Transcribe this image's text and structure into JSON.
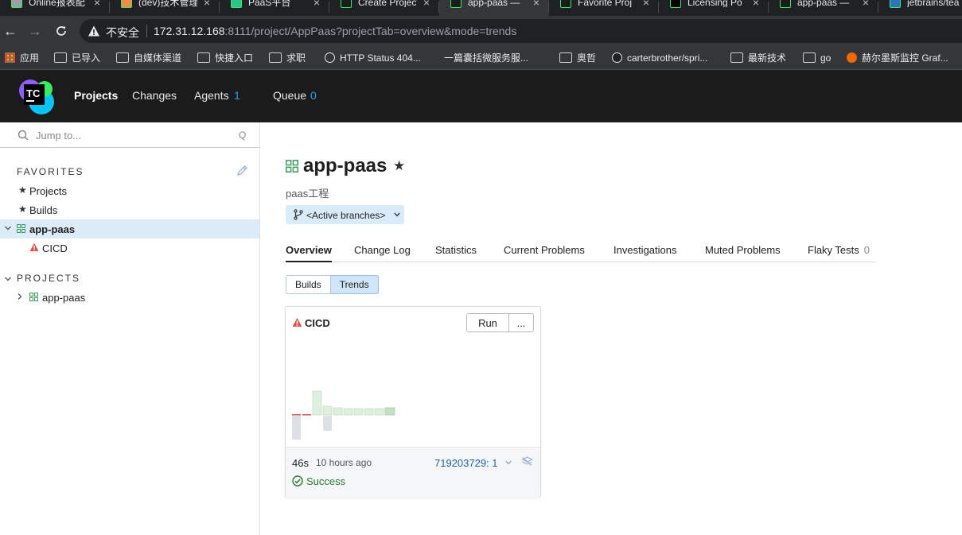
{
  "browser": {
    "tabs": [
      {
        "title": "Online报表配",
        "icon": "globe-icon",
        "color": "#9aa0a6"
      },
      {
        "title": "(dev)技术管理",
        "icon": "app-icon",
        "color": "#f48a43"
      },
      {
        "title": "PaaS平台",
        "icon": "paas-icon",
        "color": "#2fc38d"
      },
      {
        "title": "Create Project",
        "icon": "teamcity-icon",
        "color": "#1b1b1c"
      },
      {
        "title": "app-paas —",
        "icon": "teamcity-icon",
        "color": "#1b1b1c"
      },
      {
        "title": "Favorite Proj",
        "icon": "teamcity-icon",
        "color": "#1b1b1c"
      },
      {
        "title": "Licensing Po",
        "icon": "jetbrains-icon",
        "color": "#000000"
      },
      {
        "title": "app-paas —",
        "icon": "teamcity-icon",
        "color": "#1b1b1c"
      },
      {
        "title": "jetbrains/tea",
        "icon": "docker-icon",
        "color": "#2d74b8"
      }
    ],
    "insecure_label": "不安全",
    "url_host": "172.31.12.168",
    "url_rest": ":8111/project/AppPaas?projectTab=overview&mode=trends",
    "bookmarks": [
      {
        "label": "应用",
        "icon": "apps-grid-icon"
      },
      {
        "label": "已导入",
        "icon": "folder-icon"
      },
      {
        "label": "自媒体渠道",
        "icon": "folder-icon"
      },
      {
        "label": "快捷入口",
        "icon": "folder-icon"
      },
      {
        "label": "求职",
        "icon": "folder-icon"
      },
      {
        "label": "HTTP Status 404...",
        "icon": "globe-icon"
      },
      {
        "label": "一篇囊括微服务服...",
        "icon": "blank-icon"
      },
      {
        "label": "奥哲",
        "icon": "folder-icon"
      },
      {
        "label": "carterbrother/spri...",
        "icon": "github-icon"
      },
      {
        "label": "最新技术",
        "icon": "folder-icon"
      },
      {
        "label": "go",
        "icon": "folder-icon"
      },
      {
        "label": "赫尔墨斯监控 Graf...",
        "icon": "grafana-icon"
      }
    ]
  },
  "header": {
    "logo_text": "TC",
    "nav": {
      "projects": "Projects",
      "changes": "Changes",
      "agents": "Agents",
      "agents_count": "1",
      "queue": "Queue",
      "queue_count": "0"
    }
  },
  "sidebar": {
    "jump_placeholder": "Jump to...",
    "jump_shortcut": "Q",
    "favorites_title": "FAVORITES",
    "favorites": [
      {
        "label": "Projects"
      },
      {
        "label": "Builds"
      }
    ],
    "selected_project": "app-paas",
    "selected_child": "CICD",
    "projects_title": "PROJECTS",
    "projects": [
      {
        "label": "app-paas"
      }
    ]
  },
  "main": {
    "title": "app-paas",
    "description": "paas工程",
    "branch_label": "<Active branches>",
    "tabs": [
      {
        "label": "Overview",
        "active": true
      },
      {
        "label": "Change Log"
      },
      {
        "label": "Statistics"
      },
      {
        "label": "Current Problems"
      },
      {
        "label": "Investigations"
      },
      {
        "label": "Muted Problems"
      },
      {
        "label": "Flaky Tests",
        "count": "0"
      }
    ],
    "view_modes": {
      "builds": "Builds",
      "trends": "Trends",
      "selected": "Trends"
    },
    "card": {
      "title": "CICD",
      "run": "Run",
      "more": "...",
      "duration": "46s",
      "time_ago": "10 hours ago",
      "build_number": "719203729: 1",
      "status": "Success"
    }
  },
  "colors": {
    "accent_blue": "#2f9cf6",
    "header_bg": "#1b1b1c",
    "selected_bg": "#dcebf8",
    "success": "#2b7a2b",
    "failure": "#d9534f"
  }
}
